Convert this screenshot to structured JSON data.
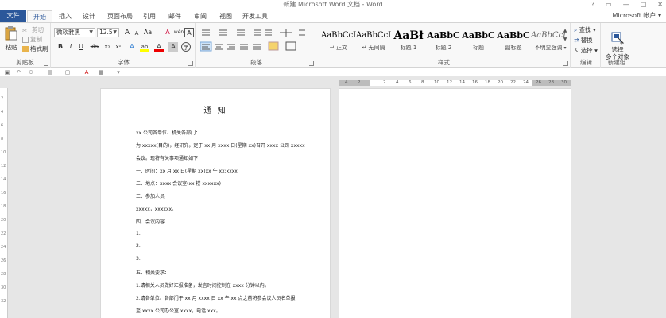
{
  "window": {
    "title": "新建 Microsoft Word 文档 - Word",
    "controls": [
      "?",
      "▭",
      "—",
      "□",
      "✕"
    ]
  },
  "tabs": [
    {
      "label": "文件"
    },
    {
      "label": "开始"
    },
    {
      "label": "插入"
    },
    {
      "label": "设计"
    },
    {
      "label": "页面布局"
    },
    {
      "label": "引用"
    },
    {
      "label": "邮件"
    },
    {
      "label": "审阅"
    },
    {
      "label": "视图"
    },
    {
      "label": "开发工具"
    }
  ],
  "account": "Microsoft 帐户 ▾",
  "ribbon": {
    "clipboard": {
      "label": "剪贴板",
      "paste": "粘贴",
      "cut": "剪切",
      "copy": "复制",
      "format_painter": "格式刷"
    },
    "font": {
      "label": "字体",
      "font_name": "微软雅黑",
      "font_size": "12.5",
      "grow": "A",
      "shrink": "A",
      "change_case": "Aa",
      "clear_format": "A",
      "phonetic": "wén",
      "border_char": "A",
      "bold": "B",
      "italic": "I",
      "underline": "U",
      "strike": "abc",
      "subscript": "x₂",
      "superscript": "x²",
      "text_effect": "A",
      "highlight": "ab",
      "font_color": "A",
      "shading": "A",
      "enclose": "字"
    },
    "paragraph": {
      "label": "段落"
    },
    "styles": {
      "label": "样式",
      "items": [
        {
          "sample": "AaBbCcI",
          "name": "↵ 正文"
        },
        {
          "sample": "AaBbCcI",
          "name": "↵ 无间隔"
        },
        {
          "sample": "AaBł",
          "name": "标题 1"
        },
        {
          "sample": "AaBbC",
          "name": "标题 2"
        },
        {
          "sample": "AaBbC",
          "name": "标题"
        },
        {
          "sample": "AaBbC",
          "name": "副标题"
        },
        {
          "sample": "AaBbCcI",
          "name": "不明显强调"
        }
      ]
    },
    "editing": {
      "label": "编辑",
      "find": "查找 ▾",
      "replace": "替换",
      "select": "选择 ▾"
    },
    "new_group": {
      "label": "新建组",
      "select_multi": "选择\n多个对象"
    }
  },
  "ruler": {
    "ticks": [
      "4",
      "2",
      "",
      "2",
      "4",
      "6",
      "8",
      "10",
      "12",
      "14",
      "16",
      "18",
      "20",
      "22",
      "24",
      "26",
      "28",
      "30"
    ],
    "vticks": [
      "2",
      "4",
      "6",
      "8",
      "10",
      "12",
      "14",
      "16",
      "18",
      "20",
      "22",
      "24",
      "26",
      "28",
      "30",
      "32"
    ]
  },
  "document": {
    "title": "通 知",
    "lines": [
      "xx 公司各单位、机关各部门：",
      "为 xxxxx(目的)，经研究，定于 xx 月 xxxx 日(星期 xx)召开 xxxx 公司 xxxxx",
      "会议。现将有关事项通知如下：",
      "一、时间：xx 月 xx 日(星期 xx)xx 午 xx:xxxx",
      "二、地点：xxxx 会议室(xx 楼 xxxxxx)",
      "三、参加人员",
      "xxxxx，xxxxxx。",
      "四、会议内容",
      "1.",
      "2.",
      "3.",
      "五、相关要求：",
      "1.请相关人员做好汇报准备，发言时间控制在 xxxx 分钟以内。",
      "2.请各单位、各部门于 xx 月 xxxx 日 xx 午 xx 点之前将参会议人员名单报",
      "至 xxxx 公司办公室 xxxx，电话 xxx。"
    ]
  },
  "colors": {
    "accent": "#2b579a",
    "workspace": "#e6e6e6"
  }
}
